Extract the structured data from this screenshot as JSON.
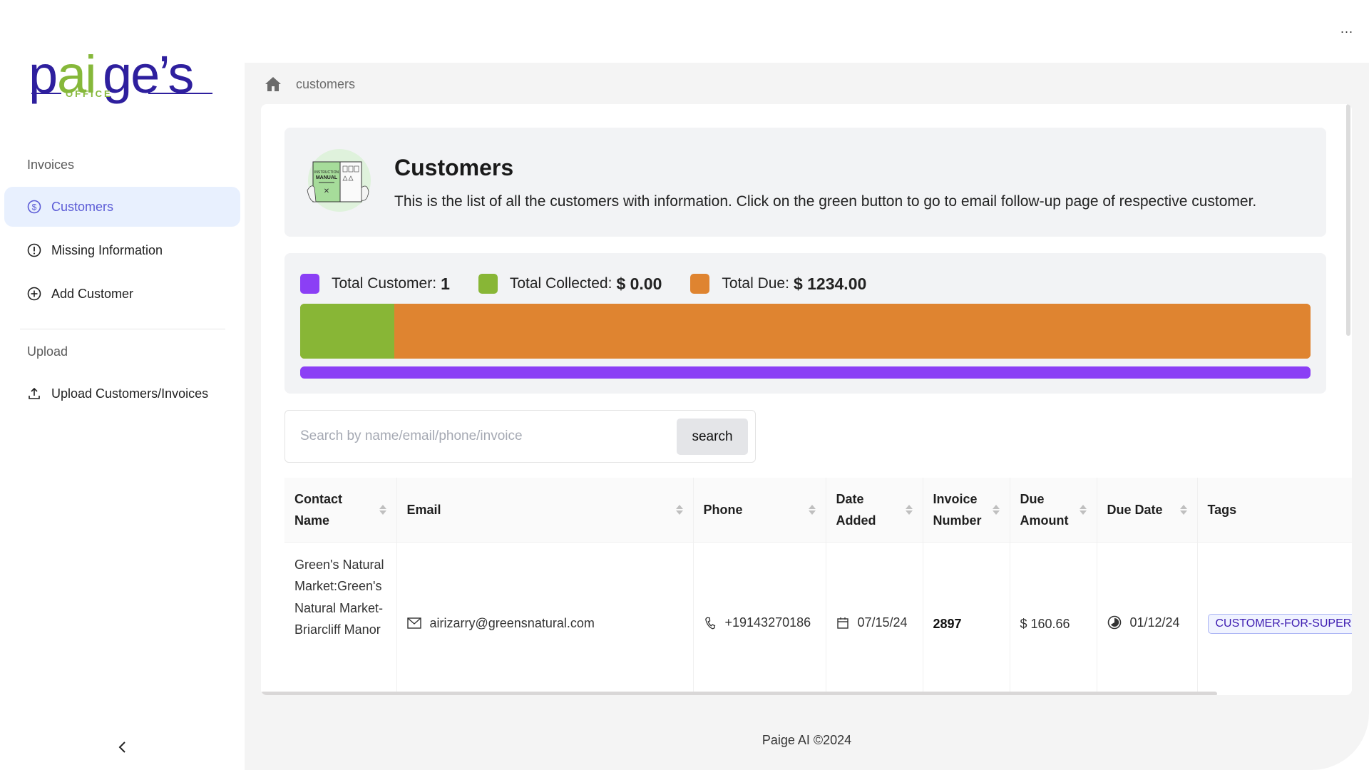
{
  "brand": {
    "name_part1": "p",
    "name_part2": "ai",
    "name_part3": "ge’s",
    "sub": "OFFICE",
    "primary_color": "#2e1f9e",
    "accent_color": "#86b83a"
  },
  "sidebar": {
    "groups": [
      {
        "label": "Invoices"
      },
      {
        "label": "Upload"
      }
    ],
    "items": [
      {
        "label": "Customers",
        "icon": "dollar-circle-icon",
        "active": true
      },
      {
        "label": "Missing Information",
        "icon": "exclamation-circle-icon",
        "active": false
      },
      {
        "label": "Add Customer",
        "icon": "plus-circle-icon",
        "active": false
      },
      {
        "label": "Upload Customers/Invoices",
        "icon": "upload-icon",
        "active": false
      }
    ],
    "collapse_icon": "chevron-left-icon"
  },
  "topbar": {
    "more_label": "..."
  },
  "breadcrumb": {
    "home_icon": "home-icon",
    "current": "customers"
  },
  "header": {
    "title": "Customers",
    "description": "This is the list of all the customers with information. Click on the green button to go to email follow-up page of respective customer."
  },
  "stats": {
    "total_customer_label": "Total Customer:",
    "total_customer_value": "1",
    "total_collected_label": "Total Collected:",
    "total_collected_value": "$ 0.00",
    "total_due_label": "Total Due:",
    "total_due_value": "$ 1234.00",
    "colors": {
      "customer": "#8b3ff5",
      "collected": "#88b636",
      "due": "#df8430"
    },
    "collected_fraction": 0.093,
    "due_fraction": 0.907,
    "customer_bar_fraction": 1.0
  },
  "search": {
    "placeholder": "Search by name/email/phone/invoice",
    "value": "",
    "button_label": "search"
  },
  "table": {
    "columns": [
      {
        "label": "Contact Name",
        "sortable": true
      },
      {
        "label": "Email",
        "sortable": true
      },
      {
        "label": "Phone",
        "sortable": true
      },
      {
        "label": "Date Added",
        "sortable": true
      },
      {
        "label": "Invoice Number",
        "sortable": true
      },
      {
        "label": "Due Amount",
        "sortable": true
      },
      {
        "label": "Due Date",
        "sortable": true
      },
      {
        "label": "Tags",
        "sortable": false
      }
    ],
    "rows": [
      {
        "contact_name": "Green's Natural Market:Green's Natural Market-Briarcliff Manor",
        "email": "airizarry@greensnatural.com",
        "phone": "+19143270186",
        "date_added": "07/15/24",
        "invoice_number": "2897",
        "due_amount": "$ 160.66",
        "due_date": "01/12/24",
        "tag": "CUSTOMER-FOR-SUPER-A"
      }
    ]
  },
  "footer": {
    "text": "Paige AI ©2024"
  }
}
